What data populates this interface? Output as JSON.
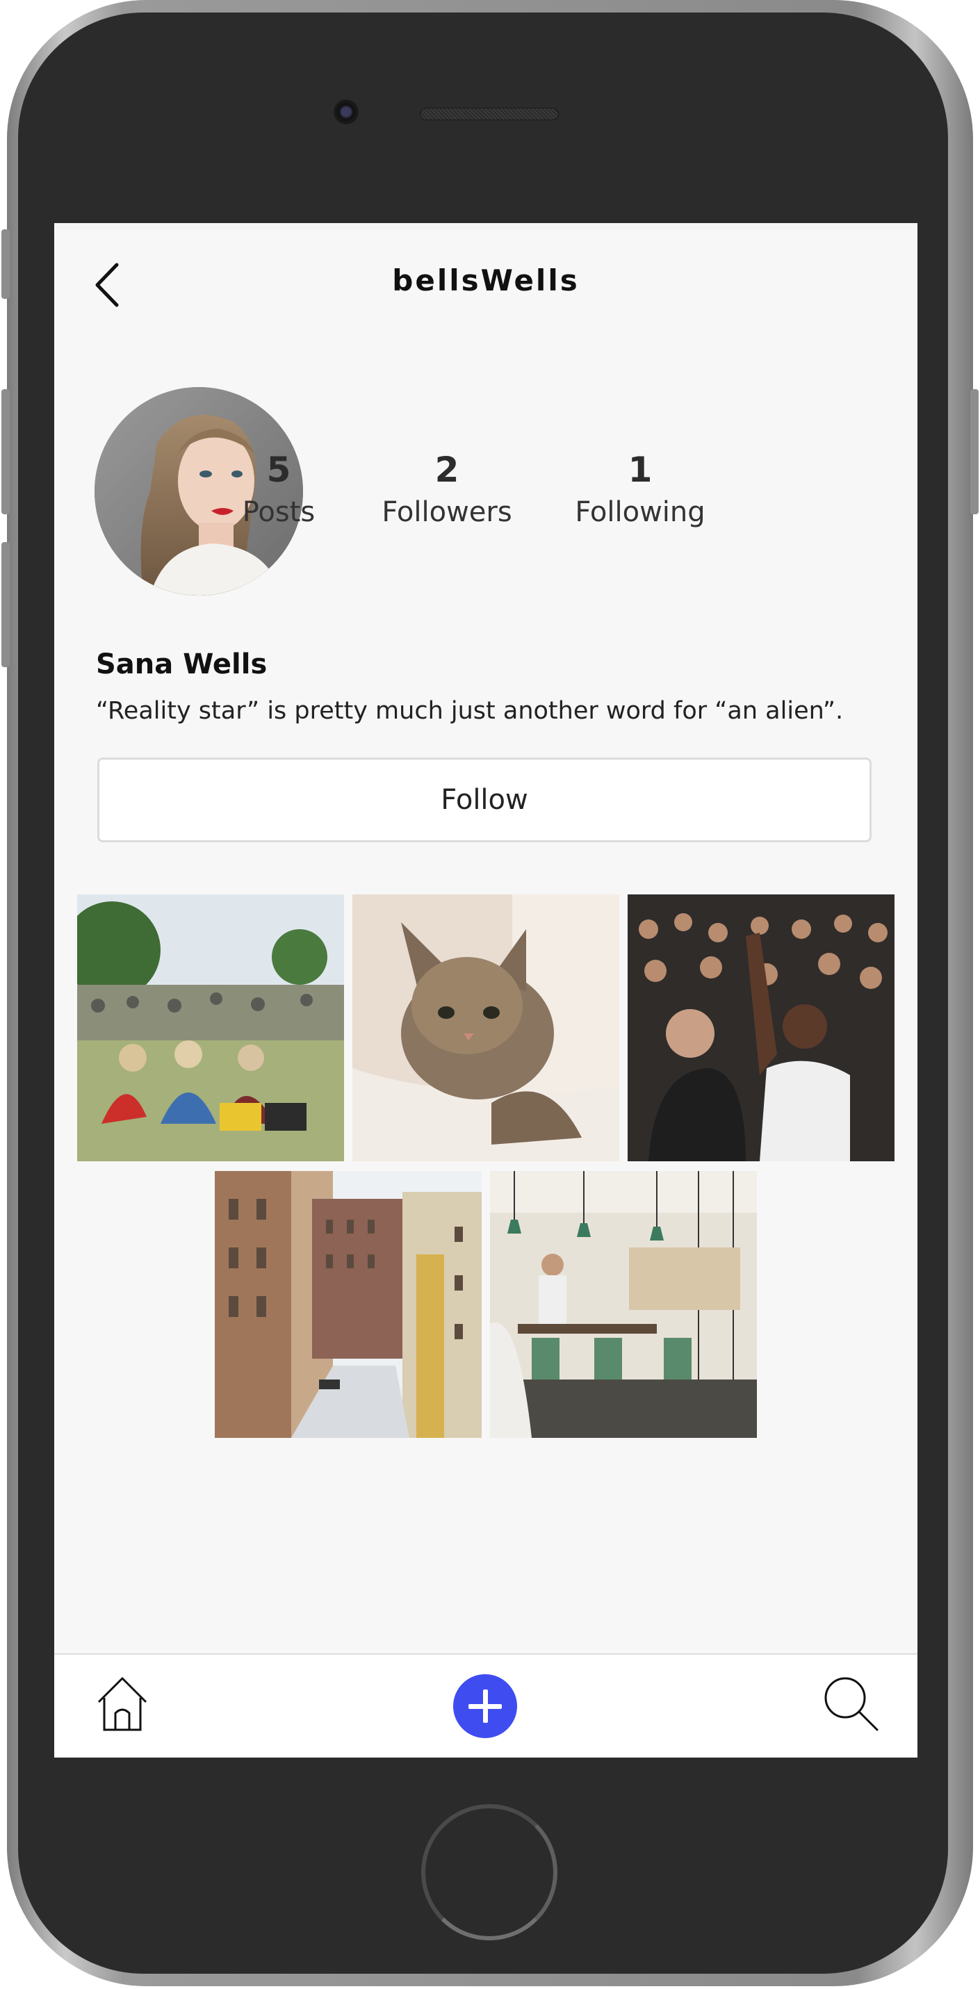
{
  "header": {
    "username": "bellsWells"
  },
  "profile": {
    "name": "Sana Wells",
    "bio": "“Reality star” is pretty much just another word for “an alien”."
  },
  "stats": {
    "posts": {
      "count": "5",
      "label": "Posts"
    },
    "followers": {
      "count": "2",
      "label": "Followers"
    },
    "following": {
      "count": "1",
      "label": "Following"
    }
  },
  "actions": {
    "follow_label": "Follow"
  },
  "posts_grid": [
    {
      "subject": "festival-crowd-photo"
    },
    {
      "subject": "kitten-photo"
    },
    {
      "subject": "concert-crowd-photo"
    },
    {
      "subject": "city-street-photo"
    },
    {
      "subject": "cafe-interior-photo"
    }
  ],
  "bottom_nav": {
    "icons": [
      "home-icon",
      "add-post-icon",
      "search-icon"
    ]
  },
  "colors": {
    "accent": "#3f4cf0",
    "screen_bg": "#f7f7f7",
    "phone_body": "#2b2b2b"
  }
}
